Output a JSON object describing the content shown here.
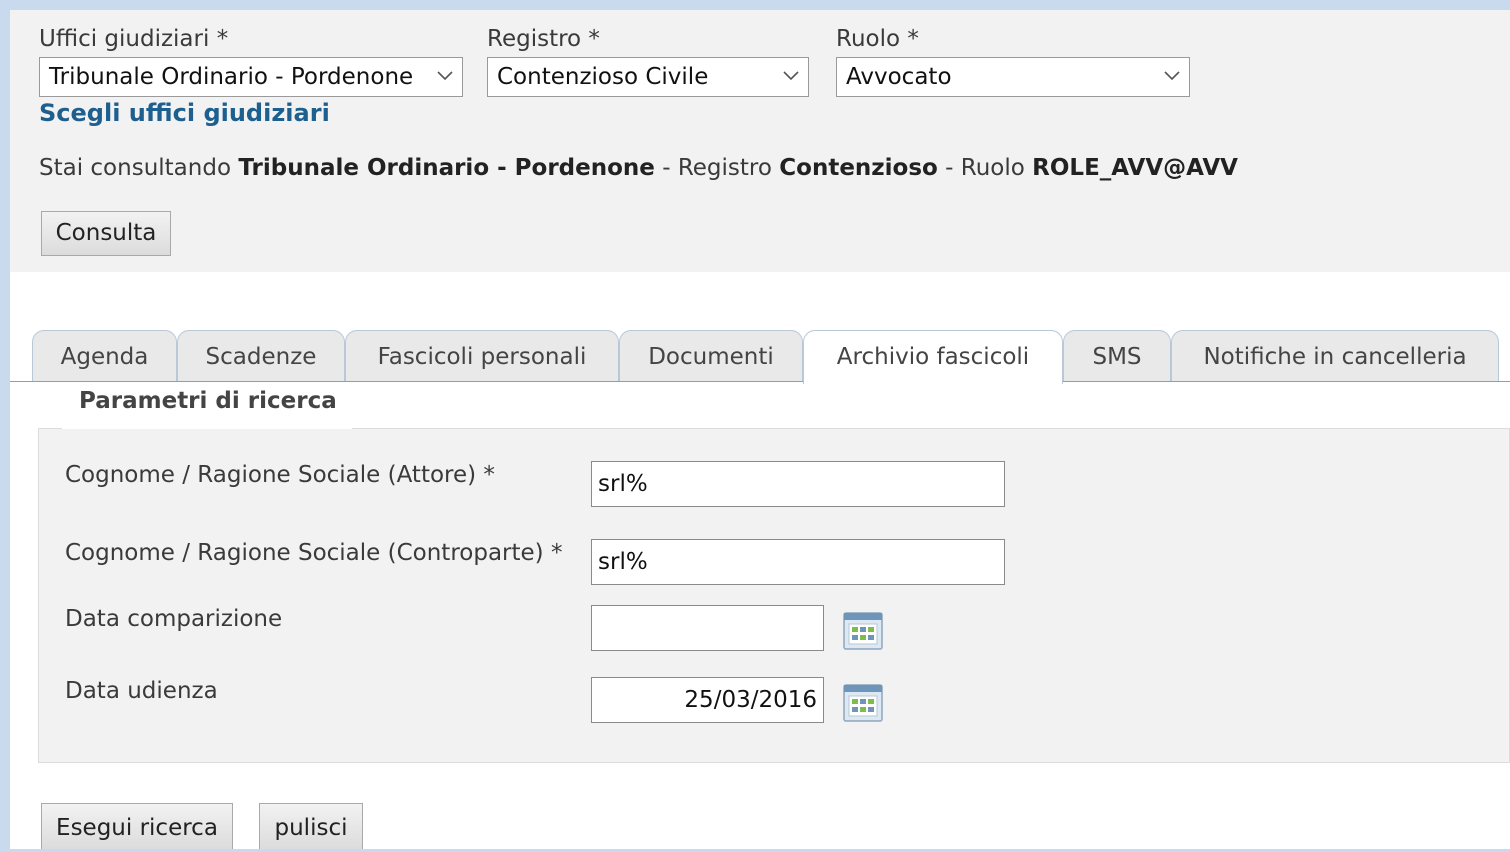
{
  "filters": {
    "uffici_label": "Uffici giudiziari *",
    "uffici_value": "Tribunale Ordinario - Pordenone",
    "registro_label": "Registro *",
    "registro_value": "Contenzioso Civile",
    "ruolo_label": "Ruolo *",
    "ruolo_value": "Avvocato",
    "choose_link": "Scegli uffici giudiziari"
  },
  "status": {
    "prefix": "Stai consultando",
    "ufficio": "Tribunale Ordinario - Pordenone",
    "registro_prefix": "- Registro",
    "registro": "Contenzioso",
    "ruolo_prefix": "- Ruolo",
    "ruolo": "ROLE_AVV@AVV"
  },
  "consulta_label": "Consulta",
  "tabs": [
    {
      "label": "Agenda",
      "active": false
    },
    {
      "label": "Scadenze",
      "active": false
    },
    {
      "label": "Fascicoli personali",
      "active": false
    },
    {
      "label": "Documenti",
      "active": false
    },
    {
      "label": "Archivio fascicoli",
      "active": true
    },
    {
      "label": "SMS",
      "active": false
    },
    {
      "label": "Notifiche in cancelleria",
      "active": false
    }
  ],
  "search": {
    "title": "Parametri di ricerca",
    "attore_label": "Cognome / Ragione Sociale (Attore) *",
    "attore_value": "srl%",
    "controparte_label": "Cognome / Ragione Sociale (Controparte) *",
    "controparte_value": "srl%",
    "data_comparizione_label": "Data comparizione",
    "data_comparizione_value": "",
    "data_udienza_label": "Data udienza",
    "data_udienza_value": "25/03/2016"
  },
  "actions": {
    "search_label": "Esegui ricerca",
    "clear_label": "pulisci"
  },
  "icons": {
    "dropdown": "chevron-down-icon",
    "calendar": "calendar-icon"
  },
  "colors": {
    "link": "#1d5f8f",
    "page_background": "#c9d9ee",
    "panel_background": "#f2f2f2"
  }
}
